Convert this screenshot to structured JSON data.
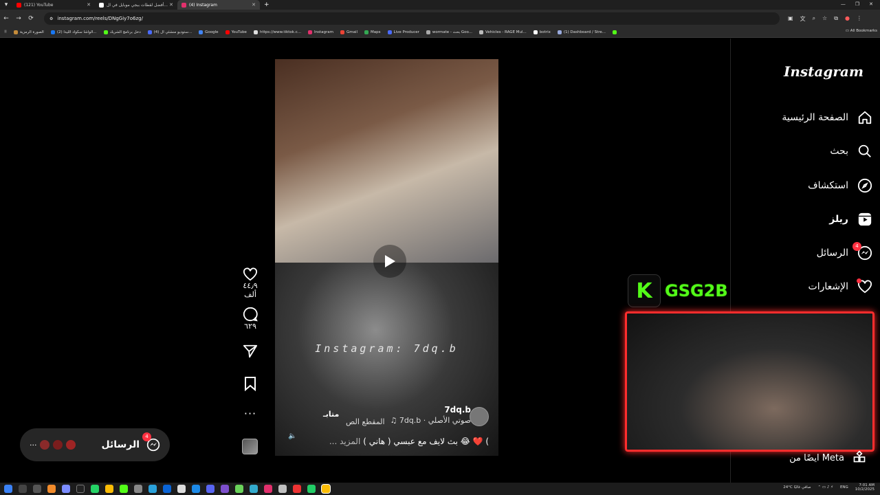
{
  "browser": {
    "tabs": [
      {
        "title": "(121) YouTube",
        "color": "#ff0000"
      },
      {
        "title": "أفضل لقطات ببجي موبايل في ال...",
        "color": "#ffffff"
      },
      {
        "title": "(4) Instagram",
        "color": "#e1306c",
        "active": true
      }
    ],
    "url": "instagram.com/reels/DNgGiy7o6zg/",
    "bookmarks": [
      "الصورة الرمزية",
      "(2) الواشا سكواد الليدا...",
      "دخل برنامج الشريك",
      "(4) ستوديو منشئي ال...",
      "Google",
      "YouTube",
      "https://www.tiktok.c...",
      "Instagram",
      "Gmail",
      "Maps",
      "Live Producer",
      "wormate - بحث Goo...",
      "Vehicles - RAGE Mul...",
      "botrix",
      "(1) Dashboard / Stre..."
    ],
    "all_bookmarks": "All Bookmarks"
  },
  "sidebar": {
    "logo": "Instagram",
    "items": [
      {
        "label": "الصفحة الرئيسية",
        "icon": "home-icon"
      },
      {
        "label": "بحث",
        "icon": "search-icon"
      },
      {
        "label": "استكشاف",
        "icon": "explore-icon"
      },
      {
        "label": "ريلز",
        "icon": "reels-icon"
      },
      {
        "label": "الرسائل",
        "icon": "messenger-icon",
        "badge": "4"
      },
      {
        "label": "الإشعارات",
        "icon": "heart-icon",
        "dot": true
      }
    ],
    "meta_label": "ايضًا من Meta"
  },
  "reel": {
    "watermark": "Instagram: 7dq.b",
    "author": "7dq.b",
    "follow": "متابـ",
    "audio": "♫ 7dq.b · صوتي الأصلي",
    "clip_label": "المقطع الص",
    "caption": "بث لايف مع عبسي ( هاني ) 😂 ❤️ (",
    "more": "... المزيد"
  },
  "actions": {
    "likes": "٤٤٫٩ ألف",
    "comments": "٦٢٩"
  },
  "messages_pill": {
    "label": "الرسائل",
    "badge": "4"
  },
  "overlay": {
    "kick_letter": "K",
    "kick_name": "GSG2B"
  },
  "tray": {
    "weather": "24°C صافي غالبًا",
    "lang": "ENG",
    "time": "7:01 AM",
    "date": "10/2/2025"
  },
  "colors": {
    "accent_red": "#ff3040",
    "kick_green": "#53fc18",
    "webcam_border": "#ff2d2d"
  }
}
